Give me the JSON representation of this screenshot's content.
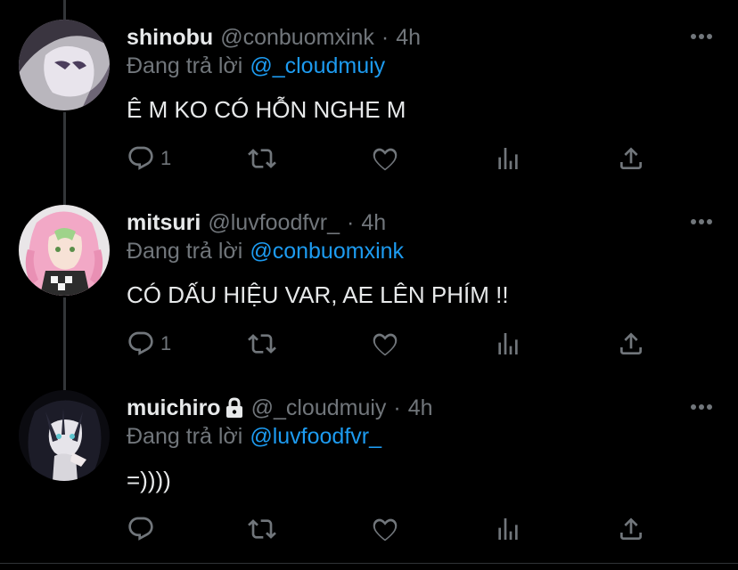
{
  "tweets": [
    {
      "name": "shinobu",
      "handle": "@conbuomxink",
      "separator": "·",
      "time": "4h",
      "reply_prefix": "Đang trả lời",
      "reply_to": "@_cloudmuiy",
      "text": "Ê M KO CÓ HỖN NGHE M",
      "reply_count": "1",
      "locked": false
    },
    {
      "name": "mitsuri",
      "handle": "@luvfoodfvr_",
      "separator": "·",
      "time": "4h",
      "reply_prefix": "Đang trả lời",
      "reply_to": "@conbuomxink",
      "text": "CÓ DẤU HIỆU VAR, AE LÊN PHÍM !!",
      "reply_count": "1",
      "locked": false
    },
    {
      "name": "muichiro",
      "handle": "@_cloudmuiy",
      "separator": "·",
      "time": "4h",
      "reply_prefix": "Đang trả lời",
      "reply_to": "@luvfoodfvr_",
      "text": "=))))",
      "reply_count": "",
      "locked": true
    }
  ],
  "colors": {
    "background": "#000000",
    "text_primary": "#e7e9ea",
    "text_secondary": "#71767b",
    "mention": "#1d9bf0",
    "thread_line": "#333639"
  },
  "icons": [
    "reply-icon",
    "retweet-icon",
    "like-icon",
    "analytics-icon",
    "share-icon",
    "more-icon",
    "lock-icon"
  ]
}
